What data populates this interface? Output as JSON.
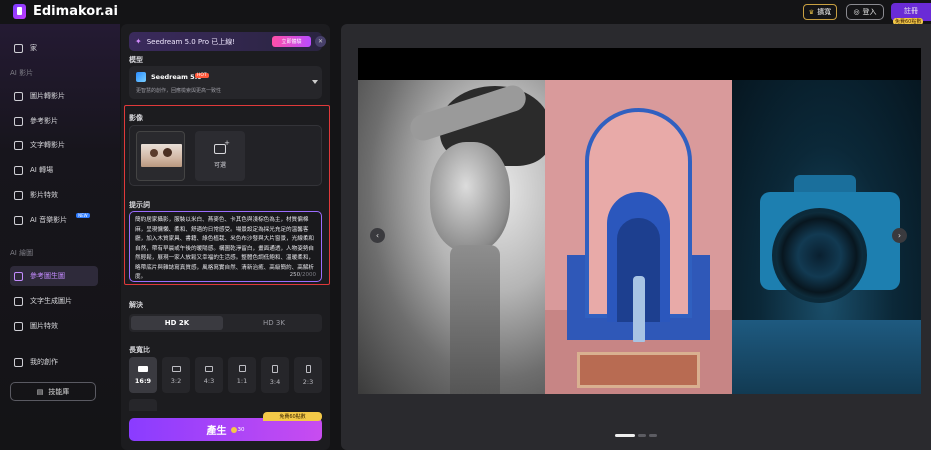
{
  "app": {
    "brand": "Edimakor.ai"
  },
  "topbar": {
    "upgrade": "擴寬",
    "login": "登入",
    "signup": "註冊",
    "signup_free": "免費60點數"
  },
  "sidebar": {
    "home": "家",
    "section_ai_video": "AI 影片",
    "video_items": [
      {
        "label": "圖片轉影片",
        "icon": "image-video-icon"
      },
      {
        "label": "參考影片",
        "icon": "reference-video-icon"
      },
      {
        "label": "文字轉影片",
        "icon": "text-video-icon"
      },
      {
        "label": "AI 轉場",
        "icon": "transition-icon"
      },
      {
        "label": "影片特效",
        "icon": "video-effects-icon"
      },
      {
        "label": "AI 音樂影片",
        "icon": "music-video-icon"
      }
    ],
    "music_badge": "NEW",
    "section_ai_image": "AI 繪圖",
    "image_items": [
      {
        "label": "參考圖生圖",
        "icon": "reference-image-icon"
      },
      {
        "label": "文字生成圖片",
        "icon": "text-image-icon"
      },
      {
        "label": "圖片特效",
        "icon": "image-effects-icon"
      }
    ],
    "my_creations": "我的創作",
    "tech_library": "技能庫"
  },
  "panel": {
    "promo": {
      "text": "Seedream 5.0 Pro 已上線!",
      "cta": "立即體驗"
    },
    "model_label": "模型",
    "model": {
      "name": "Seedream 5.0",
      "badge": "HOT",
      "desc": "更智慧的創作，回應檢索與更高一致性"
    },
    "image_label": "影像",
    "add_label": "可選",
    "prompt_label": "提示詞",
    "prompt_text": "簡約居家攝影，服裝以米白、燕麥色、卡其色與淺棕色為主，材質偏棉麻，呈現慵懶、柔和、舒適的日常感受。場景設定為採光充足的溫馨客廳，加入木質家具、書籍、綠色植栽、米色布沙發與大片窗景，光線柔和自然，帶有早晨或午後的暖陽感。構圖乾淨留白，畫面通透，人物姿勢自然輕鬆，展現一家人放鬆又幸福的生活感。整體色調低飽和、溫暖柔和，略帶底片與雜誌寫真質感，風格寫實自然、清新治癒、高級簡約、高解析度。",
    "prompt_count": "250",
    "prompt_max": "/2000",
    "resolution_label": "解決",
    "resolution": {
      "selected": "HD 2K",
      "other": "HD 3K"
    },
    "ratio_label": "長寬比",
    "ratios": [
      {
        "label": "16:9",
        "selected": true
      },
      {
        "label": "3:2",
        "selected": false
      },
      {
        "label": "4:3",
        "selected": false
      },
      {
        "label": "1:1",
        "selected": false
      },
      {
        "label": "3:4",
        "selected": false
      },
      {
        "label": "2:3",
        "selected": false
      }
    ],
    "generate": {
      "label": "產生",
      "cost": "30",
      "free_tag": "免費60點數"
    }
  },
  "preview": {
    "prev": "‹",
    "next": "›",
    "slides": 3,
    "active_slide": 1
  }
}
